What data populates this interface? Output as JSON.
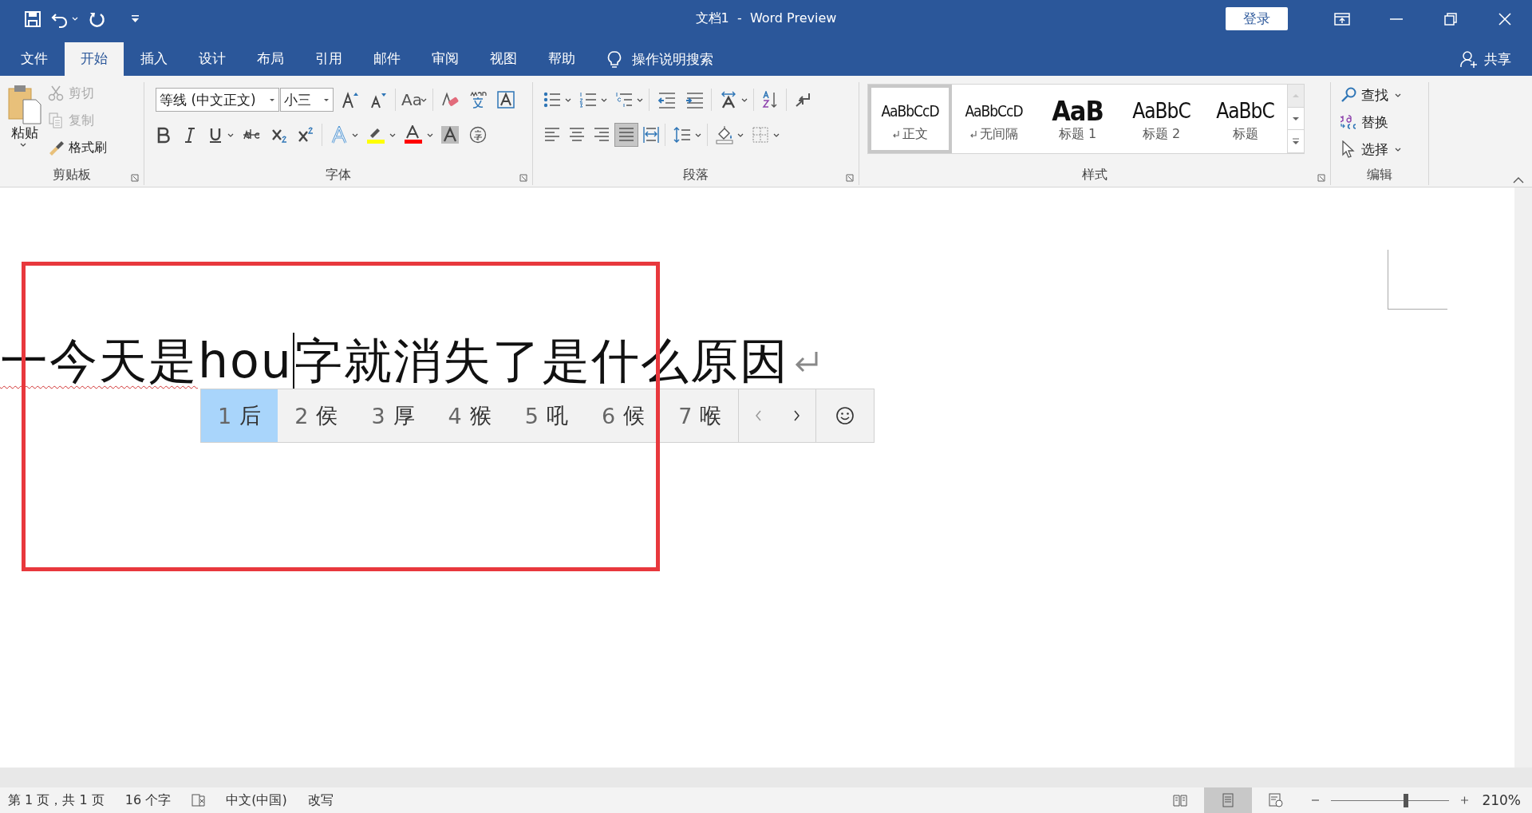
{
  "window": {
    "title": "文档1  -  Word Preview",
    "login_button": "登录"
  },
  "tabs": [
    {
      "label": "文件",
      "selected": false
    },
    {
      "label": "开始",
      "selected": true
    },
    {
      "label": "插入",
      "selected": false
    },
    {
      "label": "设计",
      "selected": false
    },
    {
      "label": "布局",
      "selected": false
    },
    {
      "label": "引用",
      "selected": false
    },
    {
      "label": "邮件",
      "selected": false
    },
    {
      "label": "审阅",
      "selected": false
    },
    {
      "label": "视图",
      "selected": false
    },
    {
      "label": "帮助",
      "selected": false
    }
  ],
  "tell_me": "操作说明搜索",
  "share": "共享",
  "clipboard": {
    "paste": "粘贴",
    "items": [
      {
        "kind": "cut",
        "label": "剪切",
        "disabled": true
      },
      {
        "kind": "copy",
        "label": "复制",
        "disabled": true
      },
      {
        "kind": "painter",
        "label": "格式刷",
        "disabled": false
      }
    ],
    "group": "剪贴板"
  },
  "font": {
    "name": "等线 (中文正文)",
    "size": "小三",
    "change_case": "Aa",
    "group": "字体"
  },
  "paragraph": {
    "group": "段落",
    "align_buttons": [
      {
        "kind": "left",
        "selected": false
      },
      {
        "kind": "center",
        "selected": false
      },
      {
        "kind": "right",
        "selected": false
      },
      {
        "kind": "justify",
        "selected": true
      },
      {
        "kind": "distributed",
        "selected": false
      }
    ]
  },
  "styles": {
    "group": "样式",
    "items": [
      {
        "kind": "body",
        "preview": "AaBbCcD",
        "label": "正文",
        "mark": true,
        "selected": true
      },
      {
        "kind": "body",
        "preview": "AaBbCcD",
        "label": "无间隔",
        "mark": true,
        "selected": false
      },
      {
        "kind": "heading1",
        "preview": "AaB",
        "label": "标题 1",
        "mark": false,
        "selected": false
      },
      {
        "kind": "heading2",
        "preview": "AaBbC",
        "label": "标题 2",
        "mark": false,
        "selected": false
      },
      {
        "kind": "title",
        "preview": "AaBbC",
        "label": "标题",
        "mark": false,
        "selected": false
      }
    ]
  },
  "editing": {
    "group": "编辑",
    "items": [
      {
        "kind": "find",
        "label": "查找",
        "menu": true
      },
      {
        "kind": "replace",
        "label": "替换",
        "menu": false
      },
      {
        "kind": "select",
        "label": "选择",
        "menu": true
      }
    ]
  },
  "document": {
    "before": "一今天是",
    "composing": "hou",
    "after": "字就消失了是什么原因"
  },
  "candidates": [
    {
      "index": "1",
      "text": "后",
      "selected": true
    },
    {
      "index": "2",
      "text": "侯",
      "selected": false
    },
    {
      "index": "3",
      "text": "厚",
      "selected": false
    },
    {
      "index": "4",
      "text": "猴",
      "selected": false
    },
    {
      "index": "5",
      "text": "吼",
      "selected": false
    },
    {
      "index": "6",
      "text": "候",
      "selected": false
    },
    {
      "index": "7",
      "text": "喉",
      "selected": false
    }
  ],
  "status_bar": {
    "page": "第 1 页，共 1 页",
    "words": "16 个字",
    "language": "中文(中国)",
    "mode": "改写",
    "views": [
      {
        "kind": "read",
        "selected": false
      },
      {
        "kind": "print",
        "selected": true
      },
      {
        "kind": "web",
        "selected": false
      }
    ],
    "zoom": {
      "level": 0.63,
      "label": "210%"
    }
  }
}
